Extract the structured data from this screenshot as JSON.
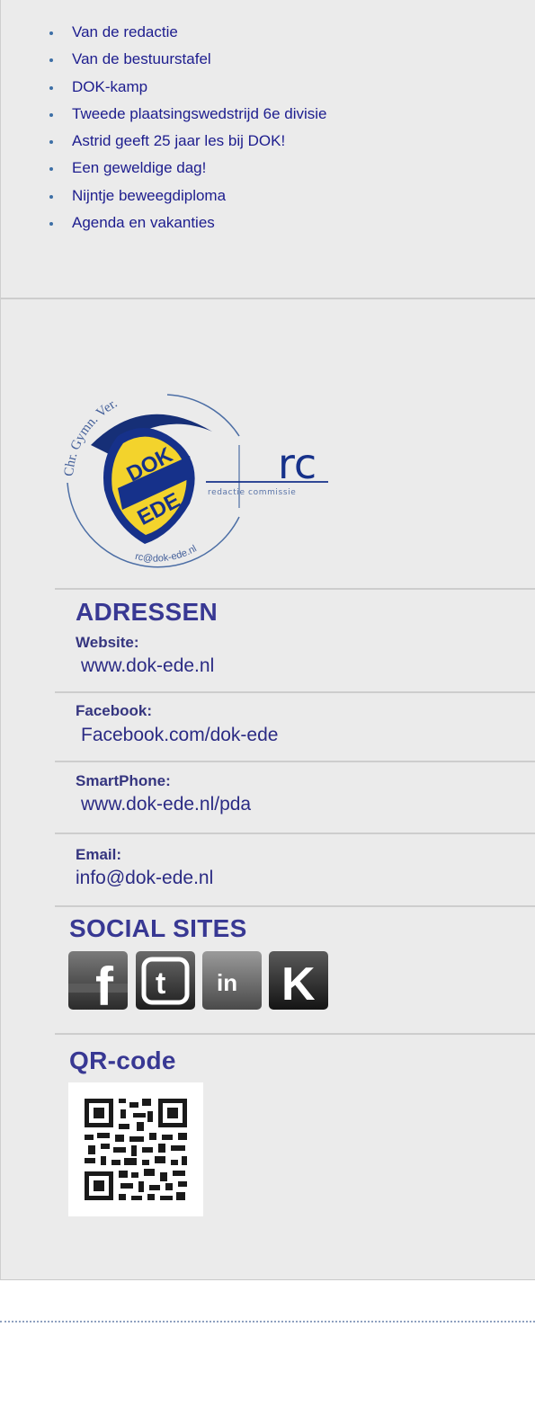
{
  "toc": {
    "items": [
      "Van de redactie",
      "Van de bestuurstafel",
      "DOK-kamp",
      "Tweede plaatsingswedstrijd 6e divisie",
      "Astrid geeft 25 jaar les bij DOK!",
      "Een geweldige dag!",
      "Nijntje beweegdiploma",
      "Agenda en vakanties"
    ]
  },
  "logo": {
    "top_text": "Chr. Gymn. Ver.",
    "shield_top": "DOK",
    "shield_bottom": "EDE",
    "rc": "rc",
    "subtitle": "redactie commissie",
    "email": "rc@dok-ede.nl"
  },
  "addresses": {
    "title": "ADRESSEN",
    "website_label": "Website:",
    "website_value": "www.dok-ede.nl",
    "facebook_label": "Facebook:",
    "facebook_value": "Facebook.com/dok-ede",
    "smartphone_label": "SmartPhone:",
    "smartphone_value": "www.dok-ede.nl/pda",
    "email_label": "Email:",
    "email_value": "info@dok-ede.nl"
  },
  "social": {
    "title": "SOCIAL SITES",
    "icons": {
      "facebook": "f",
      "twitter": "t",
      "linkedin": "in",
      "hyves": "K"
    }
  },
  "qr": {
    "title": "QR-code"
  },
  "colors": {
    "panel_bg": "#ebebeb",
    "heading": "#383893",
    "link": "#1d1d8e"
  }
}
